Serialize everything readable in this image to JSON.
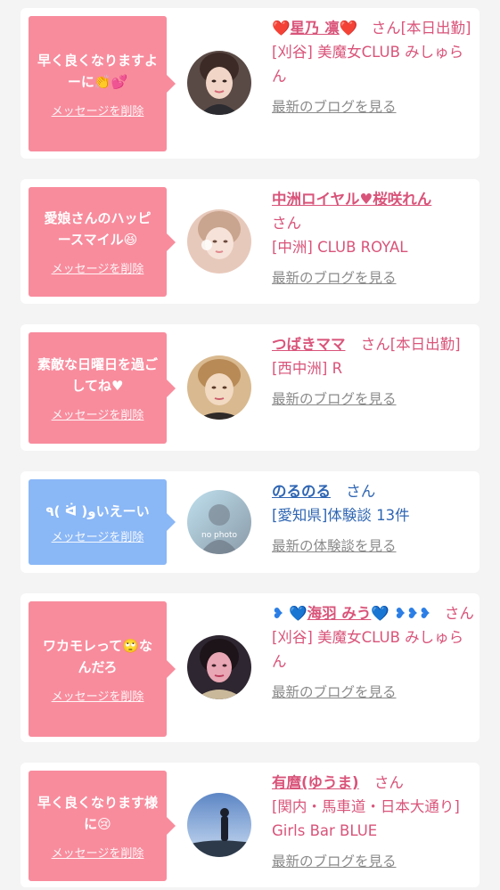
{
  "delete_label": "メッセージを削除",
  "san_label": "さん",
  "cards": [
    {
      "message": "早く良くなりますよーに👏💕",
      "name_prefix": "❤️",
      "name": "星乃 凛",
      "name_suffix": "❤️",
      "status": "[本日出勤]",
      "shop": "[刈谷] 美魔女CLUB みしゅらん",
      "link": "最新のブログを見る",
      "avatar_icon": "woman-portrait-icon"
    },
    {
      "message": "愛娘さんのハッピースマイル😆",
      "name_prefix": "",
      "name": "中洲ロイヤル♥桜咲れん",
      "name_suffix": "",
      "status": "",
      "shop": "[中洲] CLUB ROYAL",
      "link": "最新のブログを見る",
      "avatar_icon": "woman-portrait-icon"
    },
    {
      "message": "素敵な日曜日を過ごしてね♥",
      "name_prefix": "",
      "name": "つばきママ",
      "name_suffix": "",
      "status": "[本日出勤]",
      "shop": "[西中洲] R",
      "link": "最新のブログを見る",
      "avatar_icon": "woman-portrait-icon"
    },
    {
      "message": "٩( ᐛ )وいえーい",
      "name_prefix": "",
      "name": "のるのる",
      "name_suffix": "",
      "status": "",
      "shop": "[愛知県]体験談 13件",
      "link": "最新の体験談を見る",
      "avatar_icon": "no-photo-icon",
      "avatar_text": "no photo"
    },
    {
      "message": "ワカモレって🙄なんだろ",
      "name_prefix": "❥ 💙",
      "name": "海羽 みう",
      "name_suffix": "💙 ❥❥❥",
      "status": "",
      "shop": "[刈谷] 美魔女CLUB みしゅらん",
      "link": "最新のブログを見る",
      "avatar_icon": "woman-portrait-icon"
    },
    {
      "message": "早く良くなります様に😢",
      "name_prefix": "",
      "name": "有麿(ゆうま)",
      "name_suffix": "",
      "status": "",
      "shop": "[関内・馬車道・日本大通り] Girls Bar BLUE",
      "link": "最新のブログを見る",
      "avatar_icon": "landscape-portrait-icon"
    }
  ]
}
